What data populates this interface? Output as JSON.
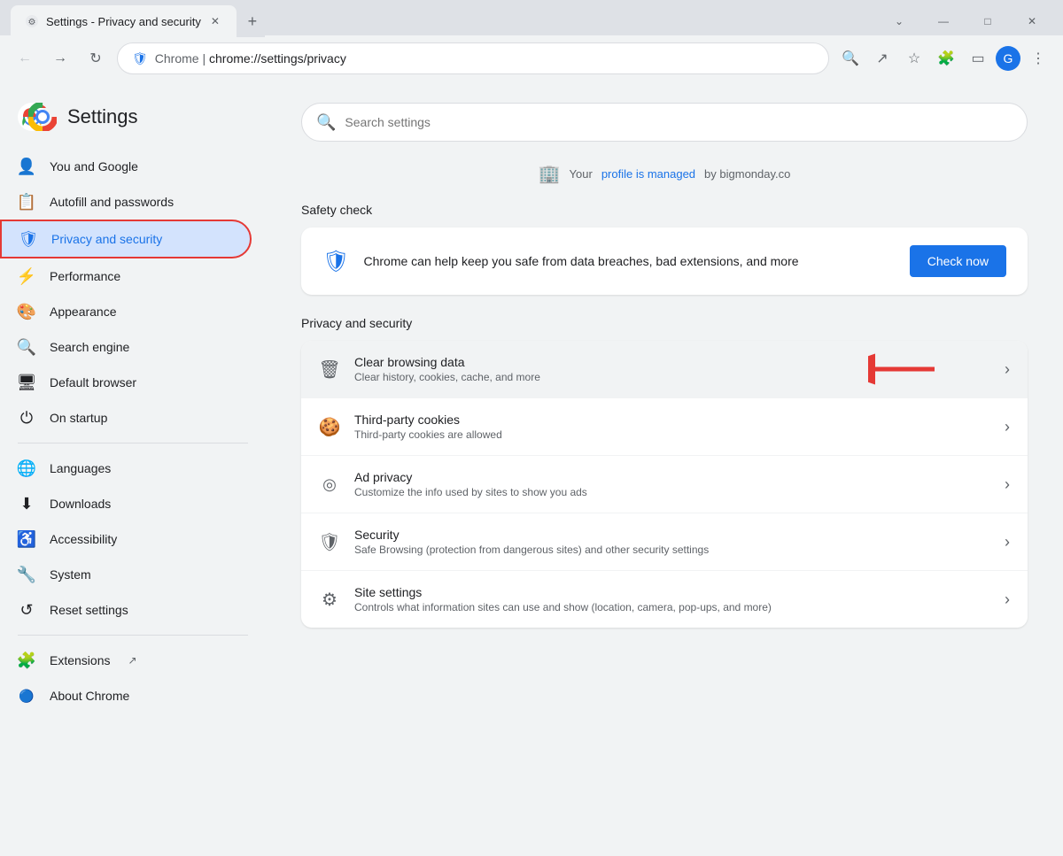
{
  "browser": {
    "tab_title": "Settings - Privacy and security",
    "tab_favicon": "⚙",
    "address_domain": "Chrome  |  ",
    "address_path": "chrome://settings/privacy",
    "window_controls": {
      "minimize": "—",
      "maximize": "□",
      "close": "✕",
      "more_tabs": "⌄"
    }
  },
  "sidebar": {
    "title": "Settings",
    "items": [
      {
        "id": "you-and-google",
        "label": "You and Google",
        "icon": "person"
      },
      {
        "id": "autofill",
        "label": "Autofill and passwords",
        "icon": "list"
      },
      {
        "id": "privacy",
        "label": "Privacy and security",
        "icon": "shield",
        "active": true
      },
      {
        "id": "performance",
        "label": "Performance",
        "icon": "gauge"
      },
      {
        "id": "appearance",
        "label": "Appearance",
        "icon": "palette"
      },
      {
        "id": "search-engine",
        "label": "Search engine",
        "icon": "search"
      },
      {
        "id": "default-browser",
        "label": "Default browser",
        "icon": "browser"
      },
      {
        "id": "on-startup",
        "label": "On startup",
        "icon": "power"
      },
      {
        "id": "languages",
        "label": "Languages",
        "icon": "globe"
      },
      {
        "id": "downloads",
        "label": "Downloads",
        "icon": "download"
      },
      {
        "id": "accessibility",
        "label": "Accessibility",
        "icon": "accessibility"
      },
      {
        "id": "system",
        "label": "System",
        "icon": "wrench"
      },
      {
        "id": "reset-settings",
        "label": "Reset settings",
        "icon": "reset"
      },
      {
        "id": "extensions",
        "label": "Extensions",
        "icon": "puzzle",
        "external": true
      },
      {
        "id": "about-chrome",
        "label": "About Chrome",
        "icon": "chrome"
      }
    ]
  },
  "search": {
    "placeholder": "Search settings"
  },
  "managed_banner": {
    "text_before": "Your ",
    "link_text": "profile is managed",
    "text_after": " by bigmonday.co"
  },
  "safety_check": {
    "section_title": "Safety check",
    "description": "Chrome can help keep you safe from data breaches, bad extensions, and more",
    "button_label": "Check now"
  },
  "privacy_section": {
    "section_title": "Privacy and security",
    "items": [
      {
        "id": "clear-browsing-data",
        "title": "Clear browsing data",
        "subtitle": "Clear history, cookies, cache, and more",
        "icon": "trash",
        "highlighted": true
      },
      {
        "id": "third-party-cookies",
        "title": "Third-party cookies",
        "subtitle": "Third-party cookies are allowed",
        "icon": "cookie"
      },
      {
        "id": "ad-privacy",
        "title": "Ad privacy",
        "subtitle": "Customize the info used by sites to show you ads",
        "icon": "ad"
      },
      {
        "id": "security",
        "title": "Security",
        "subtitle": "Safe Browsing (protection from dangerous sites) and other security settings",
        "icon": "shield-outline"
      },
      {
        "id": "site-settings",
        "title": "Site settings",
        "subtitle": "Controls what information sites can use and show (location, camera, pop-ups, and more)",
        "icon": "sliders"
      }
    ]
  }
}
